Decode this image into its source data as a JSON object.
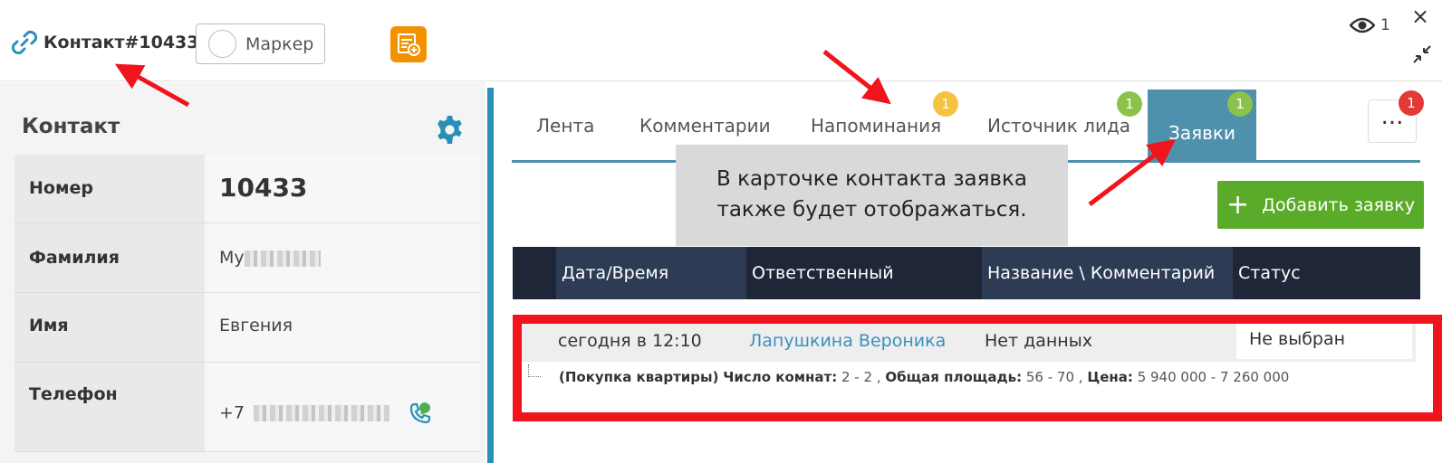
{
  "header": {
    "contact_title": "Контакт#10433",
    "marker_label": "Маркер",
    "viewers_count": "1",
    "close_label": "×"
  },
  "left_panel": {
    "title": "Контакт",
    "fields": [
      {
        "label": "Номер",
        "value": "10433"
      },
      {
        "label": "Фамилия",
        "value": "Му"
      },
      {
        "label": "Имя",
        "value": "Евгения"
      },
      {
        "label": "Телефон",
        "value": "+7"
      }
    ]
  },
  "tabs": {
    "items": [
      {
        "label": "Лента"
      },
      {
        "label": "Комментарии"
      },
      {
        "label": "Напоминания",
        "badge": "1"
      },
      {
        "label": "Источник лида",
        "badge": "1"
      },
      {
        "label": "Заявки",
        "badge": "1",
        "active": true
      }
    ],
    "more_label": "...",
    "more_badge": "1"
  },
  "callout": {
    "line1": "В карточке контакта заявка",
    "line2": "также будет отображаться."
  },
  "add_button_label": "Добавить заявку",
  "table": {
    "columns": [
      "Дата/Время",
      "Ответственный",
      "Название \\ Комментарий",
      "Статус"
    ],
    "rows": [
      {
        "date": "сегодня в 12:10",
        "responsible": "Лапушкина Вероника",
        "name": "Нет данных",
        "status": "Не выбран",
        "detail_type": "(Покупка квартиры)",
        "detail_rooms_label": "Число комнат:",
        "detail_rooms": "2 - 2",
        "detail_area_label": "Общая площадь:",
        "detail_area": "56 - 70",
        "detail_price_label": "Цена:",
        "detail_price": "5 940 000 - 7 260 000"
      }
    ]
  },
  "colors": {
    "accent": "#4f90ad",
    "orange": "#f39200",
    "green": "#5aab29",
    "annotation_red": "#f0141c",
    "badge_yellow": "#f5c242",
    "badge_green": "#8bc34a",
    "badge_red": "#e53935"
  }
}
